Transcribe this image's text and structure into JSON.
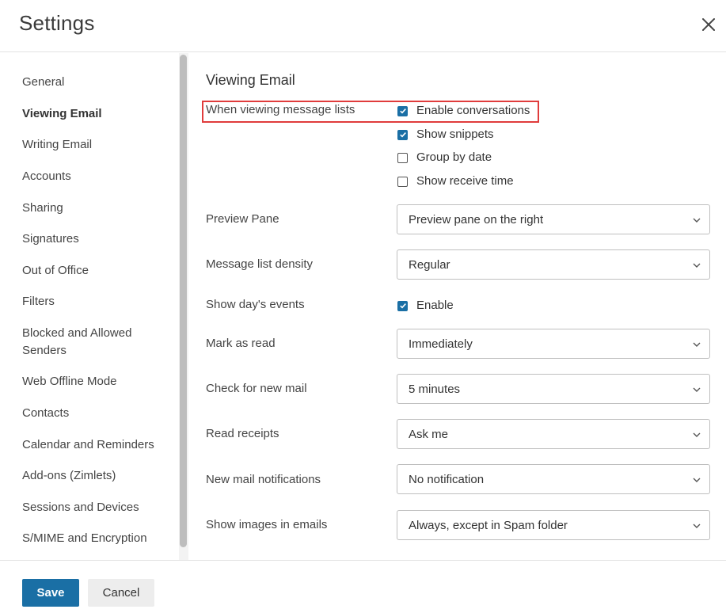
{
  "window": {
    "title": "Settings",
    "close_icon": "close-icon"
  },
  "sidebar": {
    "items": [
      {
        "label": "General",
        "active": false
      },
      {
        "label": "Viewing Email",
        "active": true
      },
      {
        "label": "Writing Email",
        "active": false
      },
      {
        "label": "Accounts",
        "active": false
      },
      {
        "label": "Sharing",
        "active": false
      },
      {
        "label": "Signatures",
        "active": false
      },
      {
        "label": "Out of Office",
        "active": false
      },
      {
        "label": "Filters",
        "active": false
      },
      {
        "label": "Blocked and Allowed Senders",
        "active": false
      },
      {
        "label": "Web Offline Mode",
        "active": false
      },
      {
        "label": "Contacts",
        "active": false
      },
      {
        "label": "Calendar and Reminders",
        "active": false
      },
      {
        "label": "Add-ons (Zimlets)",
        "active": false
      },
      {
        "label": "Sessions and Devices",
        "active": false
      },
      {
        "label": "S/MIME and Encryption",
        "active": false
      }
    ]
  },
  "main": {
    "section_title": "Viewing Email",
    "message_lists": {
      "label": "When viewing message lists",
      "options": [
        {
          "label": "Enable conversations",
          "checked": true
        },
        {
          "label": "Show snippets",
          "checked": true
        },
        {
          "label": "Group by date",
          "checked": false
        },
        {
          "label": "Show receive time",
          "checked": false
        }
      ]
    },
    "preview_pane": {
      "label": "Preview Pane",
      "value": "Preview pane on the right"
    },
    "density": {
      "label": "Message list density",
      "value": "Regular"
    },
    "days_events": {
      "label": "Show day's events",
      "option": {
        "label": "Enable",
        "checked": true
      }
    },
    "mark_as_read": {
      "label": "Mark as read",
      "value": "Immediately"
    },
    "check_new_mail": {
      "label": "Check for new mail",
      "value": "5 minutes"
    },
    "read_receipts": {
      "label": "Read receipts",
      "value": "Ask me"
    },
    "notifications": {
      "label": "New mail notifications",
      "value": "No notification"
    },
    "show_images": {
      "label": "Show images in emails",
      "value": "Always, except in Spam folder"
    }
  },
  "footer": {
    "save_label": "Save",
    "cancel_label": "Cancel"
  },
  "colors": {
    "accent": "#1a6fa5",
    "highlight": "#e03c3c"
  }
}
